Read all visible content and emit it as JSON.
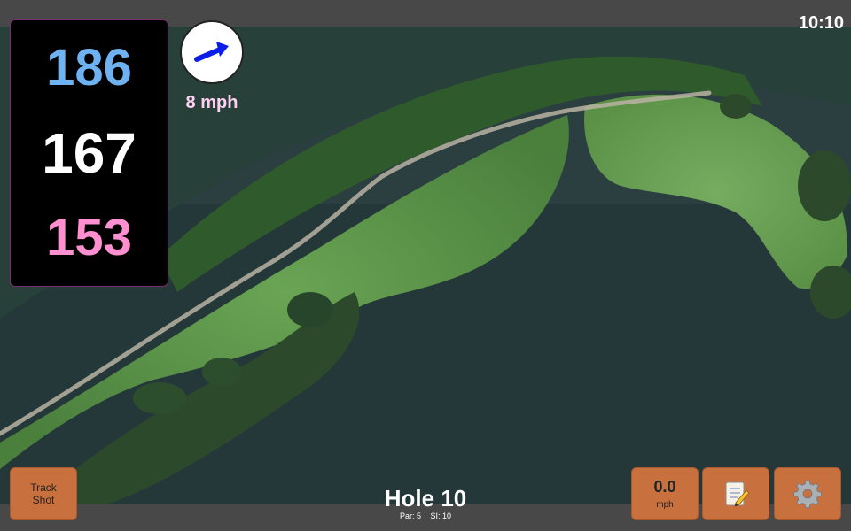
{
  "status": {
    "time": "10:10"
  },
  "yardages": {
    "back": "186",
    "middle": "167",
    "front": "153"
  },
  "wind": {
    "speed_label": "8 mph",
    "icon": "wind-arrow-icon",
    "arrow_color": "#0a1ee8"
  },
  "buttons": {
    "track_shot": {
      "line1": "Track",
      "line2": "Shot"
    },
    "speed": {
      "value": "0.0",
      "unit": "mph"
    },
    "notes": {
      "icon": "notepad-icon"
    },
    "settings": {
      "icon": "gear-icon"
    }
  },
  "hole": {
    "title": "Hole 10",
    "par_label": "Par: 5",
    "si_label": "SI: 10"
  },
  "colors": {
    "back_yardage": "#6fb2f2",
    "middle_yardage": "#ffffff",
    "front_yardage": "#ff8fcf",
    "button_orange": "#c9703f",
    "water": "#24383a",
    "fairway": "#5e9a4a"
  }
}
